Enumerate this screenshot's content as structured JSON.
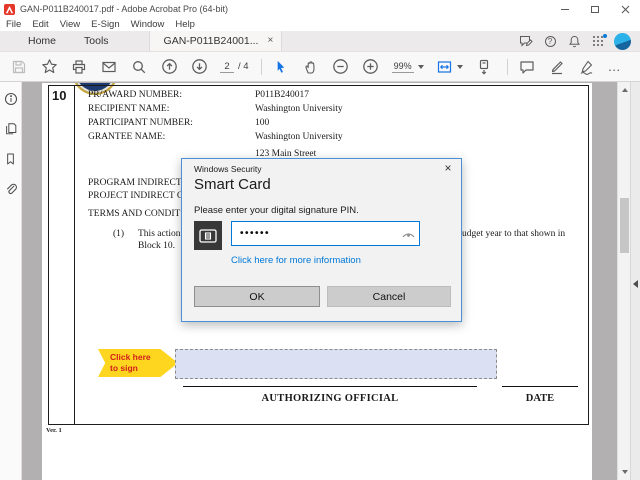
{
  "window": {
    "title": "GAN-P011B240017.pdf - Adobe Acrobat Pro (64-bit)"
  },
  "menu": {
    "items": [
      "File",
      "Edit",
      "View",
      "E-Sign",
      "Window",
      "Help"
    ]
  },
  "tabs": {
    "home": "Home",
    "tools": "Tools",
    "document": "GAN-P011B24001..."
  },
  "toolbar": {
    "page_current": "2",
    "page_total": "/ 4",
    "zoom_level": "99%"
  },
  "glyphs": {
    "close": "×",
    "ellipsis": "…",
    "help": "?"
  },
  "document": {
    "block_number": "10",
    "fields": [
      {
        "label": "PR/AWARD NUMBER:",
        "value": "P011B240017"
      },
      {
        "label": "RECIPIENT NAME:",
        "value": "Washington University"
      },
      {
        "label": "PARTICIPANT NUMBER:",
        "value": "100"
      },
      {
        "label": "GRANTEE NAME:",
        "value": "Washington University"
      },
      {
        "label": "",
        "value": "123 Main Street"
      }
    ],
    "section_fragments": [
      "PROGRAM INDIRECT",
      "PROJECT INDIRECT C",
      "TERMS AND CONDIT"
    ],
    "clause_number": "(1)",
    "clause_left": "This action ch",
    "clause_right": "udget year to that shown in",
    "clause_line2": "Block 10.",
    "sign_prompt_line1": "Click here",
    "sign_prompt_line2": "to sign",
    "authorizing_label": "AUTHORIZING OFFICIAL",
    "date_label": "DATE",
    "version": "Ver. 1"
  },
  "dialog": {
    "titlebar": "Windows Security",
    "heading": "Smart Card",
    "prompt": "Please enter your digital signature PIN.",
    "pin_value": "••••••",
    "link": "Click here for more information",
    "ok_label": "OK",
    "cancel_label": "Cancel"
  },
  "colors": {
    "accent_blue": "#1473e6",
    "dialog_border": "#4a90d2",
    "link": "#0078d7",
    "arrow_yellow": "#ffd61f",
    "arrow_text_red": "#d21e1e",
    "sig_field": "#dbe0f3"
  }
}
